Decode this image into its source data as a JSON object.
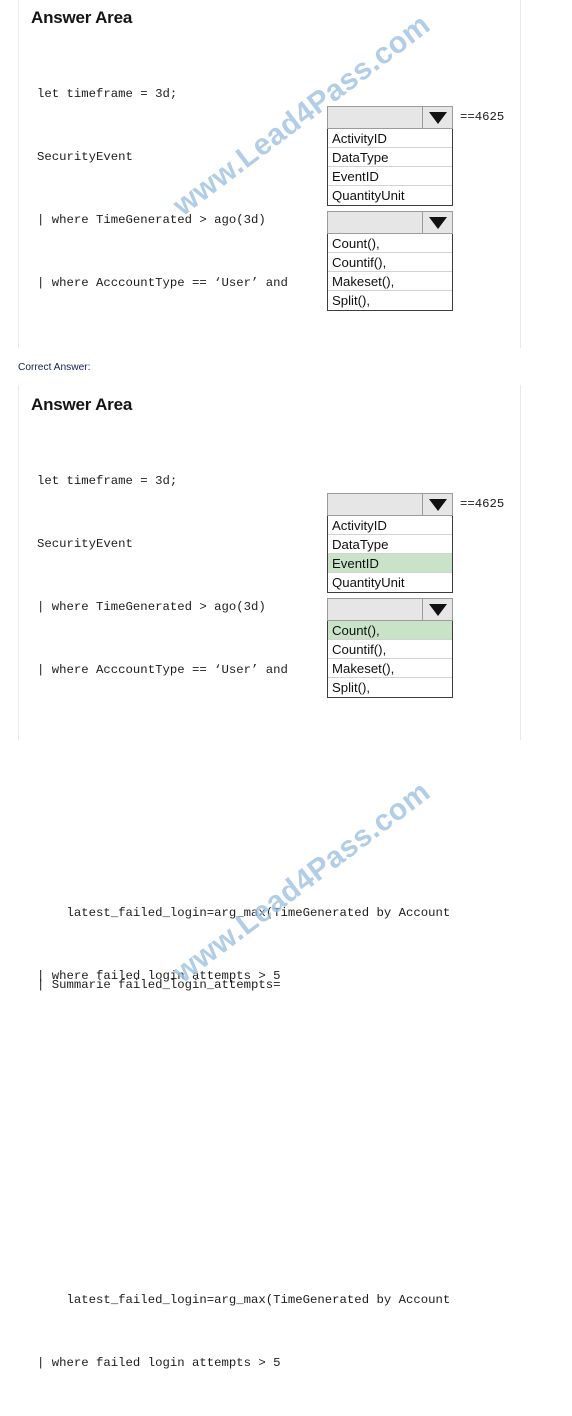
{
  "page": {
    "watermark_text": "www.Lead4Pass.com",
    "watermark_color": "#7eacd6",
    "correct_answer_caption": "Correct Answer:",
    "highlight_color": "#c9e3c8",
    "dropdown_header_color": "#e6e6e6"
  },
  "question_panel": {
    "title": "Answer Area",
    "code_before": [
      "let timeframe = 3d;",
      "SecurityEvent",
      "| where TimeGenerated > ago(3d)",
      "| where AcccountType == ‘User’ and"
    ],
    "code_middle": "| Summarie failed_login_attempts=",
    "code_after": [
      "    latest_failed_login=arg_max(TimeGenerated by Account",
      "| where failed login attempts > 5"
    ],
    "dropdown_1": {
      "name": "column-dropdown",
      "value": "",
      "suffix": "==4625",
      "options": [
        "ActivityID",
        "DataType",
        "EventID",
        "QuantityUnit"
      ],
      "selected": null
    },
    "dropdown_2": {
      "name": "aggregation-dropdown",
      "value": "",
      "suffix": "",
      "options": [
        "Count(),",
        "Countif(),",
        "Makeset(),",
        "Split(),"
      ],
      "selected": null
    }
  },
  "answer_panel": {
    "title": "Answer Area",
    "code_before": [
      "let timeframe = 3d;",
      "SecurityEvent",
      "| where TimeGenerated > ago(3d)",
      "| where AcccountType == ‘User’ and"
    ],
    "code_middle": "| Summarie failed_login_attempts=",
    "code_after": [
      "    latest_failed_login=arg_max(TimeGenerated by Account",
      "| where failed login attempts > 5"
    ],
    "dropdown_1": {
      "name": "column-dropdown",
      "value": "",
      "suffix": "==4625",
      "options": [
        "ActivityID",
        "DataType",
        "EventID",
        "QuantityUnit"
      ],
      "selected": "EventID"
    },
    "dropdown_2": {
      "name": "aggregation-dropdown",
      "value": "",
      "suffix": "",
      "options": [
        "Count(),",
        "Countif(),",
        "Makeset(),",
        "Split(),"
      ],
      "selected": "Count(),"
    }
  }
}
